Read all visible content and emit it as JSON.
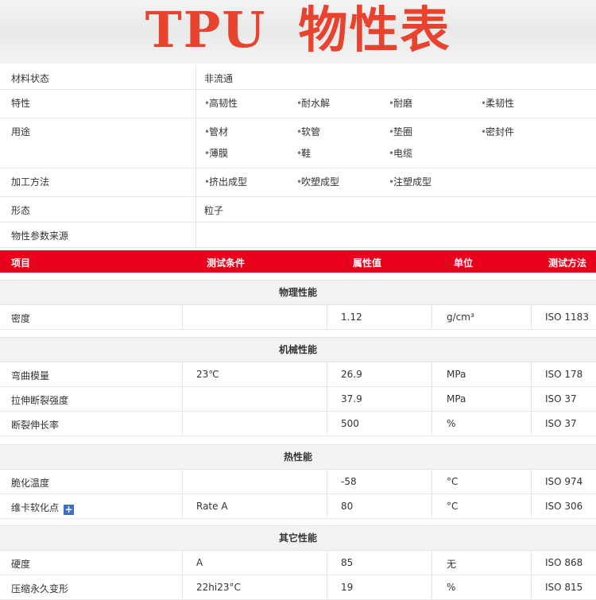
{
  "page_title": "TPU 物性表",
  "title_part1": "TPU",
  "title_part2": "物性表",
  "info": {
    "material_state_label": "材料状态",
    "material_state_value": "非流通",
    "features_label": "特性",
    "features": [
      "高韧性",
      "耐水解",
      "耐磨",
      "柔韧性"
    ],
    "uses_label": "用途",
    "uses": [
      "管材",
      "软管",
      "垫圈",
      "密封件",
      "薄膜",
      "鞋",
      "电缆"
    ],
    "processing_label": "加工方法",
    "processing": [
      "挤出成型",
      "吹塑成型",
      "注塑成型"
    ],
    "form_label": "形态",
    "form_value": "粒子",
    "source_label": "物性参数来源",
    "source_value": ""
  },
  "table_header": {
    "item": "项目",
    "condition": "测试条件",
    "value": "属性值",
    "unit": "单位",
    "method": "测试方法"
  },
  "sections": [
    {
      "title": "物理性能",
      "rows": [
        {
          "item": "密度",
          "condition": "",
          "value": "1.12",
          "unit": "g/cm³",
          "method": "ISO 1183"
        }
      ]
    },
    {
      "title": "机械性能",
      "rows": [
        {
          "item": "弯曲模量",
          "condition": "23℃",
          "value": "26.9",
          "unit": "MPa",
          "method": "ISO 178"
        },
        {
          "item": "拉伸断裂强度",
          "condition": "",
          "value": "37.9",
          "unit": "MPa",
          "method": "ISO 37"
        },
        {
          "item": "断裂伸长率",
          "condition": "",
          "value": "500",
          "unit": "%",
          "method": "ISO 37"
        }
      ]
    },
    {
      "title": "热性能",
      "rows": [
        {
          "item": "脆化温度",
          "condition": "",
          "value": "-58",
          "unit": "°C",
          "method": "ISO 974"
        },
        {
          "item": "维卡软化点",
          "condition": "Rate A",
          "value": "80",
          "unit": "°C",
          "method": "ISO 306"
        }
      ]
    },
    {
      "title": "其它性能",
      "rows": [
        {
          "item": "硬度",
          "condition": "A",
          "value": "85",
          "unit": "无",
          "method": "ISO 868"
        },
        {
          "item": "压缩永久变形",
          "condition": "22hi23°C",
          "value": "19",
          "unit": "%",
          "method": "ISO 815"
        }
      ]
    }
  ],
  "colors": {
    "title": "#e8432e",
    "header_bg": "#e8001c",
    "expand_icon": "#3c6fc7"
  },
  "icons": {
    "expand": "plus-icon"
  }
}
